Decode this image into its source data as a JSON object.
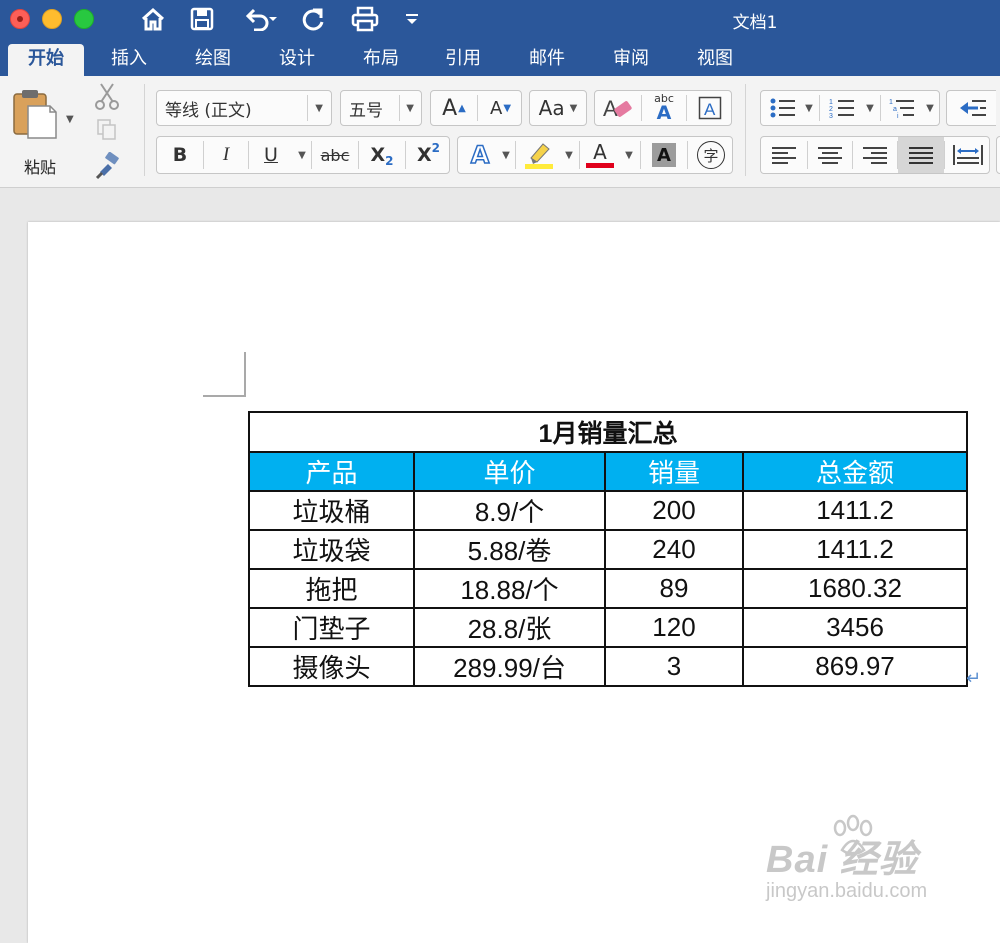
{
  "window": {
    "title": "文档1"
  },
  "tabs": [
    "开始",
    "插入",
    "绘图",
    "设计",
    "布局",
    "引用",
    "邮件",
    "审阅",
    "视图"
  ],
  "active_tab": "开始",
  "ribbon": {
    "paste_label": "粘贴",
    "font_name": "等线 (正文)",
    "font_size": "五号",
    "grow_label": "A",
    "shrink_label": "A",
    "change_case_label": "Aa",
    "phonetic_label": "abc",
    "bold_label": "B",
    "italic_label": "I",
    "underline_label": "U",
    "strike_label": "abc",
    "subscript_label": "X",
    "subscript_sub": "2",
    "superscript_label": "X",
    "superscript_sup": "2",
    "font_color_label": "A",
    "char_shading_label": "A",
    "enclose_label": "字",
    "colors": {
      "highlight": "#ffeb3b",
      "font_color": "#e0001b",
      "accent": "#2b579a"
    }
  },
  "document": {
    "table": {
      "title": "1月销量汇总",
      "headers": [
        "产品",
        "单价",
        "销量",
        "总金额"
      ],
      "header_color": "#00b0f0",
      "rows": [
        [
          "垃圾桶",
          "8.9/个",
          "200",
          "1411.2"
        ],
        [
          "垃圾袋",
          "5.88/卷",
          "240",
          "1411.2"
        ],
        [
          "拖把",
          "18.88/个",
          "89",
          "1680.32"
        ],
        [
          "门垫子",
          "28.8/张",
          "120",
          "3456"
        ],
        [
          "摄像头",
          "289.99/台",
          "3",
          "869.97"
        ]
      ]
    }
  },
  "watermark": {
    "main": "Bai  经验",
    "sub": "jingyan.baidu.com"
  }
}
